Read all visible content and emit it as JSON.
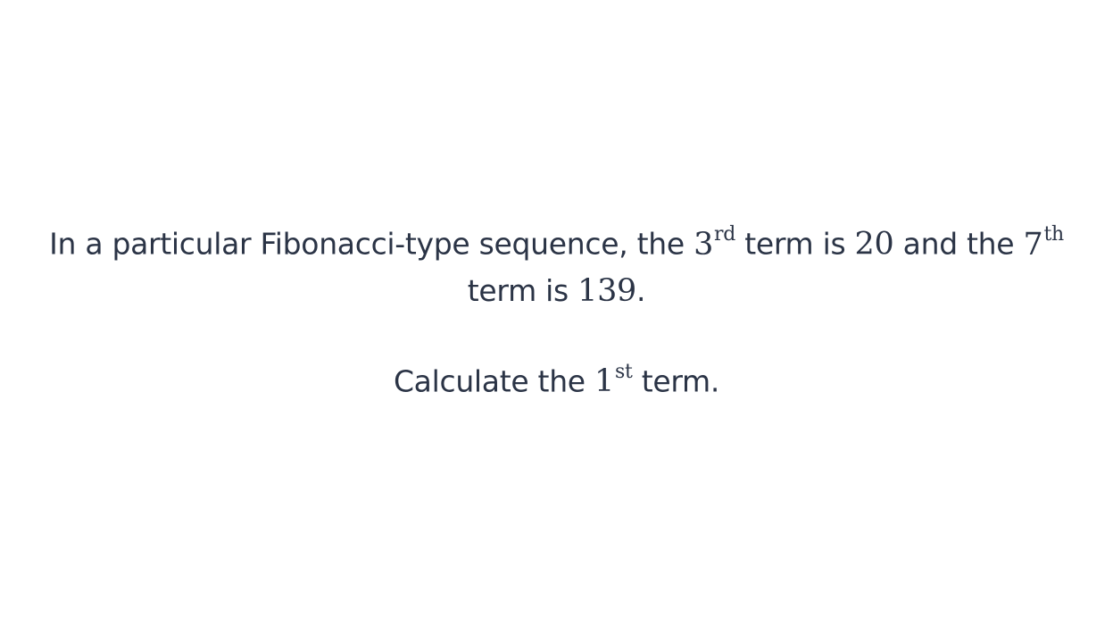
{
  "question": {
    "part1": "In a particular Fibonacci-type sequence, the ",
    "math_n3": "3",
    "math_sup_rd": "rd",
    "part2": " term is ",
    "math_20": "20",
    "part3": " and the ",
    "math_n7": "7",
    "math_sup_th": "th",
    "part4": " term is ",
    "math_139": "139",
    "part5": ".",
    "prompt_part1": "Calculate the ",
    "math_n1": "1",
    "math_sup_st": "st",
    "prompt_part2": " term."
  },
  "colors": {
    "text": "#2b3446",
    "background": "#ffffff"
  }
}
